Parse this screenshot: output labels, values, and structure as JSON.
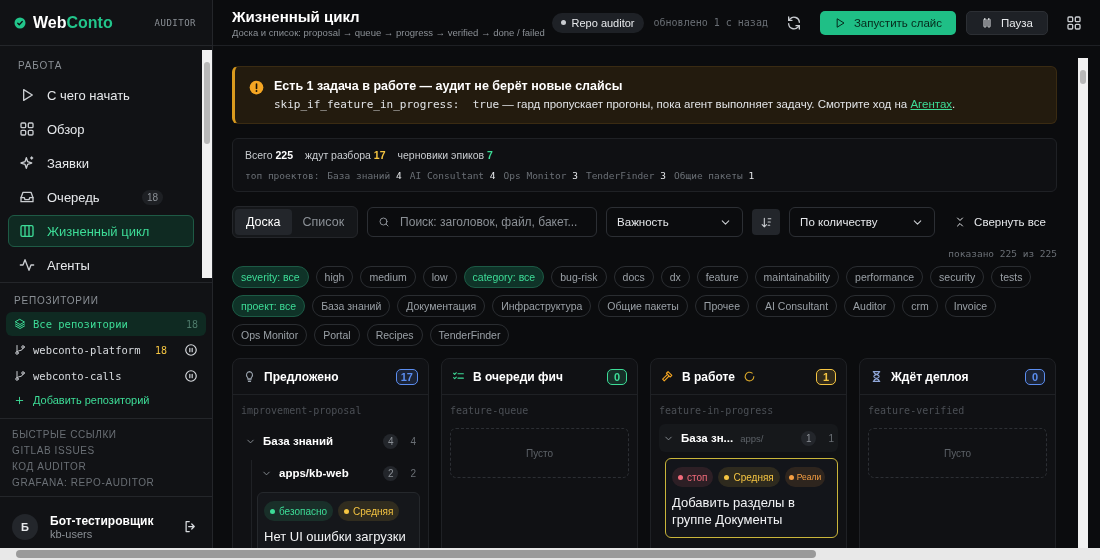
{
  "sidebar": {
    "brand_prefix": "Web",
    "brand_suffix": "Conto",
    "badge": "AUDITOR",
    "nav_title": "РАБОТА",
    "nav": [
      {
        "label": "С чего начать",
        "selected": false
      },
      {
        "label": "Обзор",
        "selected": false
      },
      {
        "label": "Заявки",
        "selected": false
      },
      {
        "label": "Очередь",
        "count": "18",
        "selected": false
      },
      {
        "label": "Жизненный цикл",
        "selected": true
      },
      {
        "label": "Агенты",
        "selected": false
      }
    ],
    "repos_title": "РЕПОЗИТОРИИ",
    "repos": [
      {
        "label": "Все репозитории",
        "count": "18",
        "selected": true,
        "paused": false
      },
      {
        "label": "webconto-platform",
        "count": "18",
        "selected": false,
        "paused": true
      },
      {
        "label": "webconto-calls",
        "selected": false,
        "paused": true
      }
    ],
    "add_repo": "Добавить репозиторий",
    "links_title": "БЫСТРЫЕ ССЫЛКИ",
    "links": [
      "GITLAB ISSUES",
      "КОД AUDITOR",
      "GRAFANA: REPO-AUDITOR"
    ],
    "user": {
      "avatar": "Б",
      "name": "Бот-тестировщик",
      "group": "kb-users"
    }
  },
  "header": {
    "title": "Жизненный цикл",
    "subtitle": "Доска и список: proposal → queue → progress → verified → done / failed",
    "status": "Repo auditor",
    "updated": "обновлено 1 с назад",
    "run_button": "Запустить слайс",
    "pause_button": "Пауза"
  },
  "banner": {
    "title": "Есть 1 задача в работе — аудит не берёт новые слайсы",
    "code": "skip_if_feature_in_progress:  true",
    "text": " — гард пропускает прогоны, пока агент выполняет задачу. Смотрите ход на ",
    "link": "Агентах",
    "tail": "."
  },
  "stats": {
    "totals": [
      {
        "label": "Всего",
        "value": "225",
        "color": "#ffffff"
      },
      {
        "label": "ждут разбора",
        "value": "17",
        "color": "#f5c542"
      },
      {
        "label": "черновики эпиков",
        "value": "7",
        "color": "#3ddc97"
      }
    ],
    "projects_label": "топ проектов:",
    "projects": [
      {
        "name": "База знаний",
        "count": "4"
      },
      {
        "name": "AI Consultant",
        "count": "4"
      },
      {
        "name": "Ops Monitor",
        "count": "3"
      },
      {
        "name": "TenderFinder",
        "count": "3"
      },
      {
        "name": "Общие пакеты",
        "count": "1"
      }
    ]
  },
  "toolbar": {
    "views": [
      {
        "label": "Доска",
        "selected": true
      },
      {
        "label": "Список",
        "selected": false
      }
    ],
    "search": {
      "placeholder": "Поиск: заголовок, файл, бакет..."
    },
    "group_select": "Важность",
    "sort_select": "По количеству",
    "collapse": "Свернуть все",
    "shown": "показано 225 из 225"
  },
  "chip_rows": [
    [
      {
        "label": "severity: все",
        "selected": true
      },
      {
        "label": "high",
        "selected": false
      },
      {
        "label": "medium",
        "selected": false
      },
      {
        "label": "low",
        "selected": false
      },
      {
        "label": "category: все",
        "selected": true
      },
      {
        "label": "bug-risk",
        "selected": false
      },
      {
        "label": "docs",
        "selected": false
      },
      {
        "label": "dx",
        "selected": false
      },
      {
        "label": "feature",
        "selected": false
      },
      {
        "label": "maintainability",
        "selected": false
      },
      {
        "label": "performance",
        "selected": false
      },
      {
        "label": "security",
        "selected": false
      },
      {
        "label": "tests",
        "selected": false
      }
    ],
    [
      {
        "label": "проект: все",
        "selected": true
      },
      {
        "label": "База знаний",
        "selected": false
      },
      {
        "label": "Документация",
        "selected": false
      },
      {
        "label": "Инфраструктура",
        "selected": false
      },
      {
        "label": "Общие пакеты",
        "selected": false
      },
      {
        "label": "Прочее",
        "selected": false
      },
      {
        "label": "AI Consultant",
        "selected": false
      },
      {
        "label": "Auditor",
        "selected": false
      },
      {
        "label": "crm",
        "selected": false
      },
      {
        "label": "Invoice",
        "selected": false
      }
    ],
    [
      {
        "label": "Ops Monitor",
        "selected": false
      },
      {
        "label": "Portal",
        "selected": false
      },
      {
        "label": "Recipes",
        "selected": false
      },
      {
        "label": "TenderFinder",
        "selected": false
      }
    ]
  ],
  "columns": [
    {
      "title": "Предложено",
      "count": "17",
      "color": "#5b8def",
      "slug": "improvement-proposal",
      "loading": false,
      "groups": [
        {
          "name": "База знаний",
          "count": "4",
          "total": "4",
          "expanded": true,
          "children": [
            {
              "name": "apps/kb-web",
              "count": "2",
              "total": "2",
              "expanded": true,
              "cards": [
                {
                  "highlighted": false,
                  "tags": [
                    {
                      "label": "безопасно",
                      "color": "#3ddc97"
                    },
                    {
                      "label": "Средняя",
                      "color": "#f5c542"
                    }
                  ],
                  "title": "Нет UI ошибки загрузки"
                }
              ]
            }
          ]
        }
      ]
    },
    {
      "title": "В очереди фич",
      "count": "0",
      "color": "#3ddc97",
      "slug": "feature-queue",
      "loading": false,
      "empty": "Пусто"
    },
    {
      "title": "В работе",
      "count": "1",
      "color": "#f5c542",
      "slug": "feature-in-progress",
      "loading": true,
      "groups": [
        {
          "name": "База зн...",
          "path": "apps/",
          "count": "1",
          "total": "1",
          "expanded": true,
          "cards": [
            {
              "highlighted": true,
              "tags": [
                {
                  "label": "стоп",
                  "color": "#f06a7a"
                },
                {
                  "label": "Средняя",
                  "color": "#f5c542"
                },
                {
                  "label": "Реали",
                  "color": "#f59e42"
                }
              ],
              "title": "Добавить разделы в группе Документы"
            }
          ]
        }
      ]
    },
    {
      "title": "Ждёт деплоя",
      "count": "0",
      "color": "#5b8def",
      "slug": "feature-verified",
      "loading": false,
      "empty": "Пусто"
    }
  ]
}
